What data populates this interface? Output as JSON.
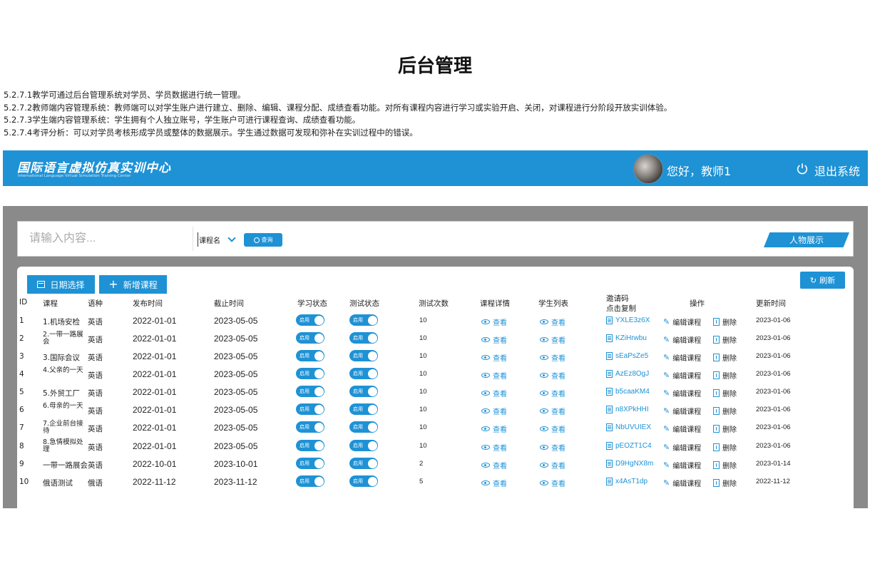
{
  "page_title": "后台管理",
  "description": [
    "5.2.7.1教学可通过后台管理系统对学员、学员数据进行统一管理。",
    "5.2.7.2教师端内容管理系统：教师端可以对学生账户进行建立、删除、编辑、课程分配、成绩查看功能。对所有课程内容进行学习或实验开启、关闭，对课程进行分阶段开放实训体验。",
    "5.2.7.3学生端内容管理系统：学生拥有个人独立账号，学生账户可进行课程查询、成绩查看功能。",
    "5.2.7.4考评分析：可以对学员考核形成学员或整体的数据展示。学生通过数据可发现和弥补在实训过程中的错误。"
  ],
  "app": {
    "logo_cn": "国际语言虚拟仿真实训中心",
    "logo_en": "International Language Virtual Simulation Training Center",
    "greeting": "您好，教师1",
    "logout": "退出系统",
    "accent_color": "#1e92d5"
  },
  "search": {
    "placeholder": "请输入内容...",
    "select_value": "课程名",
    "query_label": "查询",
    "people_label": "人物展示"
  },
  "toolbar": {
    "date_label": "日期选择",
    "add_label": "新增课程",
    "refresh_label": "刷新"
  },
  "table": {
    "headers": {
      "id": "ID",
      "course": "课程",
      "language": "语种",
      "publish": "发布时间",
      "deadline": "截止时间",
      "study": "学习状态",
      "test": "测试状态",
      "count": "测试次数",
      "detail": "课程详情",
      "students": "学生列表",
      "invite1": "邀请码",
      "invite2": "点击复制",
      "ops": "操作",
      "updated": "更新时间"
    },
    "toggle_label": "启用",
    "view_label": "查看",
    "edit_label": "编辑课程",
    "delete_label": "删除",
    "rows": [
      {
        "id": "1",
        "course": "1.机场安检",
        "lang": "英语",
        "publish": "2022-01-01",
        "deadline": "2023-05-05",
        "count": "10",
        "code": "YXLE3z6X",
        "updated": "2023-01-06"
      },
      {
        "id": "2",
        "course": "2.一带一路展会",
        "lang": "英语",
        "publish": "2022-01-01",
        "deadline": "2023-05-05",
        "count": "10",
        "code": "KZiHrwbu",
        "updated": "2023-01-06"
      },
      {
        "id": "3",
        "course": "3.国际会议",
        "lang": "英语",
        "publish": "2022-01-01",
        "deadline": "2023-05-05",
        "count": "10",
        "code": "sEaPsZe5",
        "updated": "2023-01-06"
      },
      {
        "id": "4",
        "course": "4.父亲的一天",
        "lang": "英语",
        "publish": "2022-01-01",
        "deadline": "2023-05-05",
        "count": "10",
        "code": "AzEz8OgJ",
        "updated": "2023-01-06"
      },
      {
        "id": "5",
        "course": "5.外贸工厂",
        "lang": "英语",
        "publish": "2022-01-01",
        "deadline": "2023-05-05",
        "count": "10",
        "code": "b5caaKM4",
        "updated": "2023-01-06"
      },
      {
        "id": "6",
        "course": "6.母亲的一天",
        "lang": "英语",
        "publish": "2022-01-01",
        "deadline": "2023-05-05",
        "count": "10",
        "code": "n8XPkHHI",
        "updated": "2023-01-06"
      },
      {
        "id": "7",
        "course": "7.企业前台接待",
        "lang": "英语",
        "publish": "2022-01-01",
        "deadline": "2023-05-05",
        "count": "10",
        "code": "NbUVUIEX",
        "updated": "2023-01-06"
      },
      {
        "id": "8",
        "course": "8.急情模拟处理",
        "lang": "英语",
        "publish": "2022-01-01",
        "deadline": "2023-05-05",
        "count": "10",
        "code": "pEOZT1C4",
        "updated": "2023-01-06"
      },
      {
        "id": "9",
        "course": "一带一路展会",
        "lang": "英语",
        "publish": "2022-10-01",
        "deadline": "2023-10-01",
        "count": "2",
        "code": "D9HgNX8m",
        "updated": "2023-01-14"
      },
      {
        "id": "10",
        "course": "俄语测试",
        "lang": "俄语",
        "publish": "2022-11-12",
        "deadline": "2023-11-12",
        "count": "5",
        "code": "x4AsT1dp",
        "updated": "2022-11-12"
      }
    ]
  }
}
